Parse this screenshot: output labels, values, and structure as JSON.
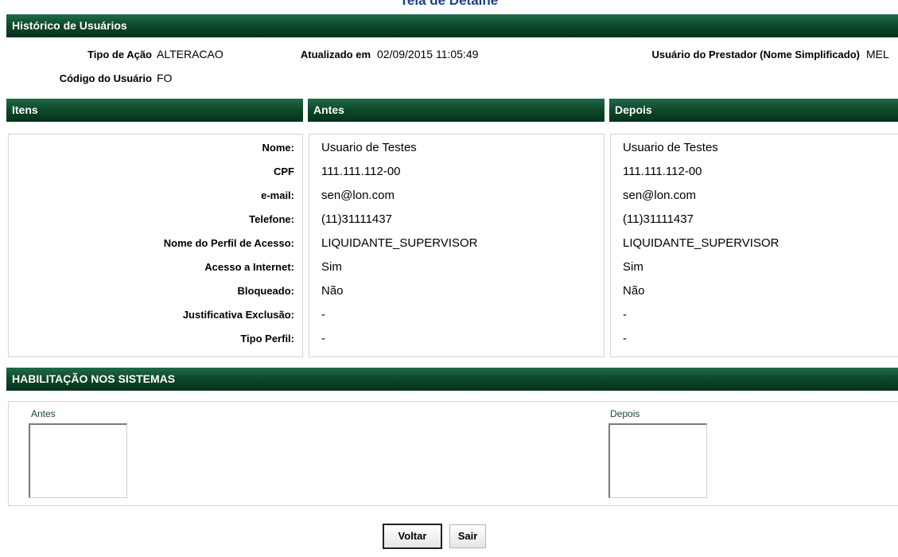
{
  "page_title": "Tela de Detalhe",
  "section_title": "Histórico de Usuários",
  "info": {
    "tipo_acao_label": "Tipo de Ação",
    "tipo_acao_value": "ALTERACAO",
    "atualizado_label": "Atualizado em",
    "atualizado_value": "02/09/2015 11:05:49",
    "usuario_prestador_label": "Usuário do Prestador (Nome Simplificado)",
    "usuario_prestador_value": "MEL",
    "codigo_label": "Código do Usuário",
    "codigo_value": "FO"
  },
  "columns": {
    "itens": "Itens",
    "antes": "Antes",
    "depois": "Depois"
  },
  "rows": [
    {
      "label": "Nome:",
      "antes": "Usuario de Testes",
      "depois": "Usuario de Testes"
    },
    {
      "label": "CPF",
      "antes": "111.111.112-00",
      "depois": "111.111.112-00"
    },
    {
      "label": "e-mail:",
      "antes": "sen@lon.com",
      "depois": "sen@lon.com"
    },
    {
      "label": "Telefone:",
      "antes": "(11)31111437",
      "depois": "(11)31111437"
    },
    {
      "label": "Nome do Perfil de Acesso:",
      "antes": "LIQUIDANTE_SUPERVISOR",
      "depois": "LIQUIDANTE_SUPERVISOR"
    },
    {
      "label": "Acesso a Internet:",
      "antes": "Sim",
      "depois": "Sim"
    },
    {
      "label": "Bloqueado:",
      "antes": "Não",
      "depois": "Não"
    },
    {
      "label": "Justificativa Exclusão:",
      "antes": "-",
      "depois": "-"
    },
    {
      "label": "Tipo Perfil:",
      "antes": "-",
      "depois": "-"
    }
  ],
  "habilitacao": {
    "title": "HABILITAÇÃO NOS SISTEMAS",
    "antes_label": "Antes",
    "depois_label": "Depois"
  },
  "buttons": {
    "voltar": "Voltar",
    "sair": "Sair"
  }
}
